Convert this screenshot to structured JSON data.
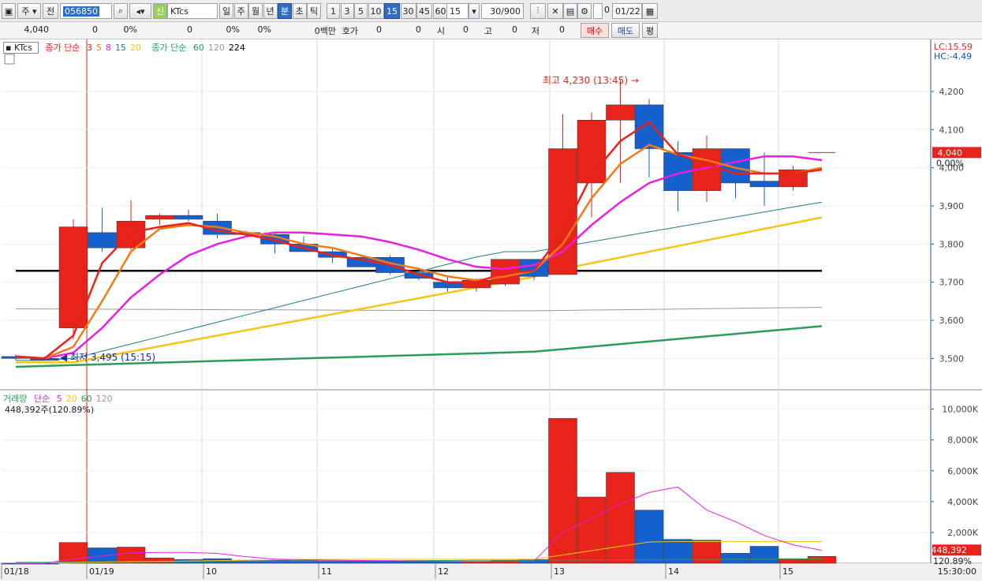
{
  "toolbar": {
    "market": "주",
    "prev_label": "전",
    "code": "056850",
    "stock_name": "KTcs",
    "period_buttons": [
      "일",
      "주",
      "월",
      "년",
      "분",
      "초",
      "틱"
    ],
    "selected_period": "분",
    "interval_buttons": [
      "1",
      "3",
      "5",
      "10",
      "15",
      "30",
      "45",
      "60"
    ],
    "selected_interval": "15",
    "interval_value": "15",
    "count": "30/900",
    "checkbox_value": "0",
    "date": "01/22"
  },
  "infobar": {
    "price": "4,040",
    "change": "0",
    "change_pct": "0%",
    "volume": "0",
    "vol_pct": "0%",
    "vol_pct2": "0%",
    "amount": "0백만",
    "quote_label": "호가",
    "quote_val1": "0",
    "quote_val2": "0",
    "open_label": "시",
    "open_val": "0",
    "high_label": "고",
    "high_val": "0",
    "low_label": "저",
    "low_val": "0",
    "buy_btn": "매수",
    "sell_btn": "매도",
    "eval_btn": "평"
  },
  "price_legend": {
    "name": "KTcs",
    "ma1_label": "종가 단순",
    "ma1_periods": [
      "3",
      "5",
      "8",
      "15",
      "20"
    ],
    "ma2_label": "종가 단순",
    "ma2_periods": [
      "60",
      "120",
      "224"
    ]
  },
  "price_panel": {
    "lc": "LC:15.59",
    "hc": "HC:-4.49",
    "current_price_label": "4,040",
    "current_pct_label": "0.00%",
    "high_annotation": "최고 4,230 (13:45)",
    "low_annotation": "최저 3,495 (15:15)",
    "y_ticks": [
      "4,200",
      "4,100",
      "4,000",
      "3,900",
      "3,800",
      "3,700",
      "3,600",
      "3,500"
    ]
  },
  "volume_legend": {
    "label": "거래량",
    "ma_label": "단순",
    "periods": [
      "5",
      "20",
      "60",
      "120"
    ],
    "current": "448,392주(120.89%)"
  },
  "volume_panel": {
    "y_ticks": [
      "10,000K",
      "8,000K",
      "6,000K",
      "4,000K",
      "2,000K"
    ],
    "current_value_label": "448,392",
    "current_pct_label": "120.89%"
  },
  "x_axis": {
    "labels": [
      "01/18",
      "01/19",
      "10",
      "11",
      "12",
      "13",
      "14",
      "15"
    ],
    "end_time": "15:30:00"
  },
  "colors": {
    "up": "#e8231a",
    "down": "#1560cf",
    "ma3": "#e8231a",
    "ma5": "#f07a1a",
    "ma8": "#e81fe0",
    "ma15": "#1e7b8a",
    "ma20": "#f5c518",
    "ma60": "#2e9b5e",
    "ma120": "#999999",
    "ma224": "#000000"
  },
  "chart_data": {
    "type": "candlestick",
    "candles": [
      {
        "o": 3505,
        "h": 3510,
        "l": 3495,
        "c": 3500
      },
      {
        "o": 3500,
        "h": 3505,
        "l": 3495,
        "c": 3495
      },
      {
        "o": 3580,
        "h": 3865,
        "l": 3550,
        "c": 3845
      },
      {
        "o": 3830,
        "h": 3895,
        "l": 3780,
        "c": 3790
      },
      {
        "o": 3790,
        "h": 3915,
        "l": 3785,
        "c": 3860
      },
      {
        "o": 3865,
        "h": 3880,
        "l": 3850,
        "c": 3875
      },
      {
        "o": 3875,
        "h": 3890,
        "l": 3860,
        "c": 3865
      },
      {
        "o": 3860,
        "h": 3880,
        "l": 3815,
        "c": 3825
      },
      {
        "o": 3830,
        "h": 3835,
        "l": 3820,
        "c": 3825
      },
      {
        "o": 3825,
        "h": 3830,
        "l": 3775,
        "c": 3800
      },
      {
        "o": 3800,
        "h": 3820,
        "l": 3780,
        "c": 3780
      },
      {
        "o": 3780,
        "h": 3790,
        "l": 3750,
        "c": 3765
      },
      {
        "o": 3765,
        "h": 3770,
        "l": 3740,
        "c": 3740
      },
      {
        "o": 3765,
        "h": 3770,
        "l": 3720,
        "c": 3725
      },
      {
        "o": 3725,
        "h": 3730,
        "l": 3705,
        "c": 3710
      },
      {
        "o": 3700,
        "h": 3715,
        "l": 3675,
        "c": 3685
      },
      {
        "o": 3685,
        "h": 3710,
        "l": 3675,
        "c": 3705
      },
      {
        "o": 3695,
        "h": 3760,
        "l": 3690,
        "c": 3760
      },
      {
        "o": 3760,
        "h": 3760,
        "l": 3705,
        "c": 3715
      },
      {
        "o": 3720,
        "h": 4140,
        "l": 3720,
        "c": 4050
      },
      {
        "o": 3960,
        "h": 4145,
        "l": 3870,
        "c": 4125
      },
      {
        "o": 4125,
        "h": 4230,
        "l": 3960,
        "c": 4165
      },
      {
        "o": 4165,
        "h": 4180,
        "l": 3975,
        "c": 4050
      },
      {
        "o": 4040,
        "h": 4070,
        "l": 3885,
        "c": 3940
      },
      {
        "o": 3940,
        "h": 4085,
        "l": 3910,
        "c": 4050
      },
      {
        "o": 4050,
        "h": 4050,
        "l": 3920,
        "c": 3960
      },
      {
        "o": 3965,
        "h": 4040,
        "l": 3900,
        "c": 3950
      },
      {
        "o": 3950,
        "h": 4005,
        "l": 3940,
        "c": 3995
      },
      {
        "o": 4040,
        "h": 4040,
        "l": 4040,
        "c": 4040
      }
    ],
    "volumes_k": [
      0,
      0,
      1350,
      1000,
      1050,
      350,
      250,
      300,
      200,
      200,
      180,
      150,
      130,
      120,
      110,
      110,
      110,
      170,
      250,
      9400,
      4300,
      5900,
      3450,
      1550,
      1500,
      650,
      1100,
      300,
      448
    ],
    "ma_lines": {
      "ma3": [
        3505,
        3500,
        3560,
        3750,
        3830,
        3845,
        3855,
        3835,
        3825,
        3810,
        3790,
        3770,
        3760,
        3745,
        3720,
        3700,
        3700,
        3725,
        3730,
        3830,
        3980,
        4070,
        4120,
        4035,
        4010,
        3985,
        3985,
        3985,
        3995
      ],
      "ma5": [
        3505,
        3500,
        3530,
        3650,
        3780,
        3840,
        3850,
        3845,
        3830,
        3820,
        3800,
        3790,
        3770,
        3750,
        3735,
        3715,
        3705,
        3715,
        3730,
        3800,
        3920,
        4010,
        4060,
        4035,
        4020,
        4000,
        3985,
        3985,
        4000
      ],
      "ma8": [
        3505,
        3500,
        3515,
        3580,
        3660,
        3720,
        3770,
        3800,
        3820,
        3830,
        3830,
        3825,
        3820,
        3805,
        3785,
        3760,
        3740,
        3735,
        3745,
        3780,
        3850,
        3910,
        3960,
        3985,
        4000,
        4015,
        4030,
        4030,
        4020
      ]
    }
  }
}
